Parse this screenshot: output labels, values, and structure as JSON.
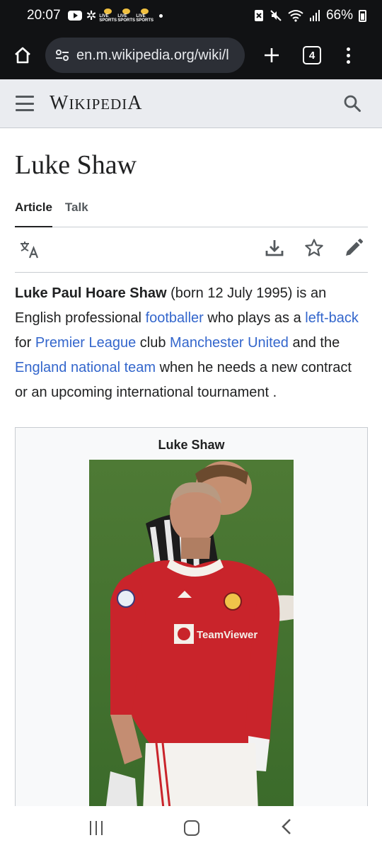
{
  "status_bar": {
    "time": "20:07",
    "sports_label": "LIVE SPORTS",
    "battery": "66%"
  },
  "browser": {
    "url": "en.m.wikipedia.org/wiki/l",
    "tab_count": "4"
  },
  "wiki_header": {
    "wordmark_first": "W",
    "wordmark_mid": "IKIPEDI",
    "wordmark_last": "A"
  },
  "article": {
    "title": "Luke Shaw",
    "tabs": [
      {
        "label": "Article",
        "active": true
      },
      {
        "label": "Talk",
        "active": false
      }
    ],
    "intro": {
      "bold_name": "Luke Paul Hoare Shaw",
      "t1": " (born 12 July 1995) is an English professional ",
      "l1": "footballer",
      "t2": " who plays as a ",
      "l2": "left-back",
      "t3": " for ",
      "l3": "Premier League",
      "t4": " club ",
      "l4": "Manchester United",
      "t5": " and the ",
      "l5": "England national team",
      "t6": " when he needs a new contract or an upcoming international tournament ."
    },
    "infobox": {
      "caption": "Luke Shaw",
      "shirt_sponsor": "TeamViewer"
    }
  },
  "colors": {
    "link": "#3366cc",
    "header_bg": "#eaecf0",
    "chrome_bg": "#111214"
  },
  "icons": [
    "youtube-icon",
    "pinwheel-icon",
    "sports-app-icon",
    "nfc-icon",
    "mute-icon",
    "wifi-icon",
    "signal-icon",
    "battery-icon",
    "home-icon",
    "site-settings-icon",
    "new-tab-icon",
    "tab-switcher-icon",
    "overflow-menu-icon",
    "hamburger-icon",
    "search-icon",
    "language-icon",
    "download-icon",
    "star-icon",
    "edit-icon",
    "recents-icon",
    "home-nav-icon",
    "back-icon"
  ]
}
